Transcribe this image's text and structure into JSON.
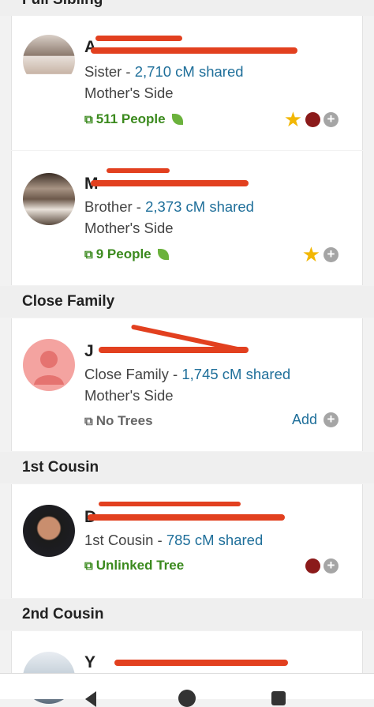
{
  "sections": {
    "full_sibling": "Full Sibling",
    "close_family": "Close Family",
    "first_cousin": "1st Cousin",
    "second_cousin": "2nd Cousin"
  },
  "matches": [
    {
      "name": "A",
      "relationship": "Sister - ",
      "cm": "2,710 cM shared",
      "side": "Mother's Side",
      "tree": "511 People",
      "starred": true,
      "dot_color": "#8b1a1a"
    },
    {
      "name": "M",
      "relationship": "Brother - ",
      "cm": "2,373 cM shared",
      "side": "Mother's Side",
      "tree": "9 People",
      "starred": true
    },
    {
      "name": "J",
      "relationship": "Close Family - ",
      "cm": "1,745 cM shared",
      "side": "Mother's Side",
      "tree": "No Trees",
      "add_label": "Add"
    },
    {
      "name": "D",
      "relationship": "1st Cousin - ",
      "cm": "785 cM shared",
      "tree": "Unlinked Tree",
      "dot_color": "#8b1a1a"
    },
    {
      "name": "Y"
    }
  ],
  "colors": {
    "link": "#1f6f9a",
    "tree_green": "#3b8a1e",
    "star": "#f2b705",
    "redaction": "#e2401f"
  },
  "icons": {
    "tree": "tree-branch-icon",
    "no_tree": "no-tree-icon",
    "leaf": "leaf-hint-icon",
    "star": "star-icon",
    "plus": "plus-circle-icon"
  }
}
